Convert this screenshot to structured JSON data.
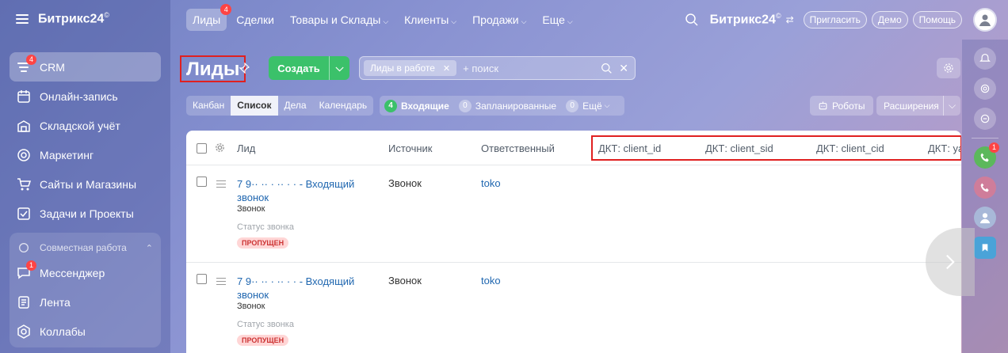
{
  "sidebar": {
    "brand": "Битрикс24",
    "brand_mark": "©",
    "items": [
      {
        "label": "CRM",
        "badge": "4"
      },
      {
        "label": "Онлайн-запись"
      },
      {
        "label": "Складской учёт"
      },
      {
        "label": "Маркетинг"
      },
      {
        "label": "Сайты и Магазины"
      },
      {
        "label": "Задачи и Проекты"
      }
    ],
    "group": {
      "label": "Совместная работа",
      "items": [
        {
          "label": "Мессенджер",
          "badge": "1"
        },
        {
          "label": "Лента"
        },
        {
          "label": "Коллабы"
        }
      ]
    }
  },
  "topnav": {
    "items": [
      {
        "label": "Лиды",
        "badge": "4"
      },
      {
        "label": "Сделки"
      },
      {
        "label": "Товары и Склады"
      },
      {
        "label": "Клиенты"
      },
      {
        "label": "Продажи"
      },
      {
        "label": "Еще"
      }
    ],
    "brand": "Битрикс24",
    "brand_mark": "©",
    "invite": "Пригласить",
    "demo": "Демо",
    "help": "Помощь"
  },
  "toolbar": {
    "title": "Лиды",
    "create": "Создать",
    "filter_tag": "Лиды в работе",
    "search_placeholder": "+ поиск"
  },
  "views": [
    "Канбан",
    "Список",
    "Дела",
    "Календарь"
  ],
  "counters": [
    {
      "num": "4",
      "label": "Входящие"
    },
    {
      "num": "0",
      "label": "Запланированные"
    },
    {
      "num": "0",
      "label": "Ещё"
    }
  ],
  "robots": "Роботы",
  "extensions": "Расширения",
  "grid": {
    "columns": {
      "lead": "Лид",
      "source": "Источник",
      "responsible": "Ответственный",
      "dkt1": "ДКТ: client_id",
      "dkt2": "ДКТ: client_sid",
      "dkt3": "ДКТ: client_cid",
      "dkt4": "ДКТ: ya"
    },
    "rows": [
      {
        "title_line1": "7 9·· ·· · ·· · · - Входящий",
        "title_line2": "звонок",
        "sub": "Звонок",
        "status_label": "Статус звонка",
        "status": "ПРОПУЩЕН",
        "source": "Звонок",
        "responsible": "toko"
      },
      {
        "title_line1": "7 9·· ·· · ·· · · - Входящий",
        "title_line2": "звонок",
        "sub": "Звонок",
        "status_label": "Статус звонка",
        "status": "ПРОПУЩЕН",
        "source": "Звонок",
        "responsible": "toko"
      }
    ]
  },
  "colors": {
    "accent_green": "#3bc16a",
    "link_blue": "#2067b0",
    "badge_red": "#ff4444",
    "highlight_red": "#e02020"
  }
}
